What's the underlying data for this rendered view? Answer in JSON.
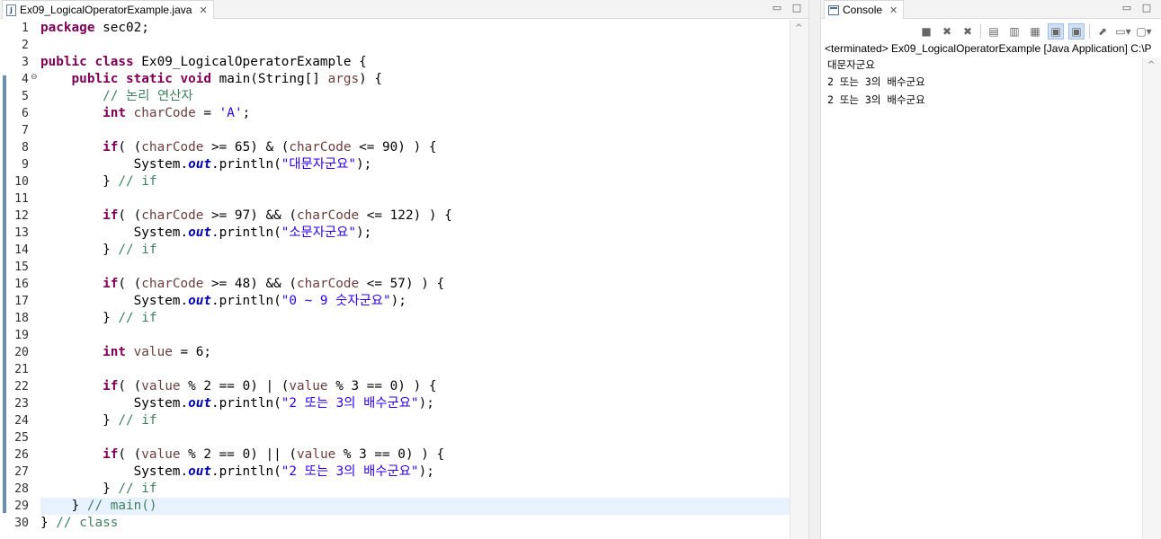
{
  "editor": {
    "tab_label": "Ex09_LogicalOperatorExample.java",
    "tab_icon": "java-file-icon",
    "line_numbers": [
      "1",
      "2",
      "3",
      "4",
      "5",
      "6",
      "7",
      "8",
      "9",
      "10",
      "11",
      "12",
      "13",
      "14",
      "15",
      "16",
      "17",
      "18",
      "19",
      "20",
      "21",
      "22",
      "23",
      "24",
      "25",
      "26",
      "27",
      "28",
      "29",
      "30"
    ],
    "current_line": 29,
    "lines": [
      [
        {
          "t": "package",
          "c": "kw"
        },
        {
          "t": " sec02;"
        }
      ],
      [],
      [
        {
          "t": "public",
          "c": "kw"
        },
        {
          "t": " "
        },
        {
          "t": "class",
          "c": "kw"
        },
        {
          "t": " Ex09_LogicalOperatorExample {"
        }
      ],
      [
        {
          "t": "    "
        },
        {
          "t": "public",
          "c": "kw"
        },
        {
          "t": " "
        },
        {
          "t": "static",
          "c": "kw"
        },
        {
          "t": " "
        },
        {
          "t": "void",
          "c": "kw"
        },
        {
          "t": " main(String[] "
        },
        {
          "t": "args",
          "c": "var"
        },
        {
          "t": ") {"
        }
      ],
      [
        {
          "t": "        "
        },
        {
          "t": "// 논리 연산자",
          "c": "cmt"
        }
      ],
      [
        {
          "t": "        "
        },
        {
          "t": "int",
          "c": "kw"
        },
        {
          "t": " "
        },
        {
          "t": "charCode",
          "c": "var"
        },
        {
          "t": " = "
        },
        {
          "t": "'A'",
          "c": "str"
        },
        {
          "t": ";"
        }
      ],
      [],
      [
        {
          "t": "        "
        },
        {
          "t": "if",
          "c": "kw"
        },
        {
          "t": "( ("
        },
        {
          "t": "charCode",
          "c": "var"
        },
        {
          "t": " >= 65) & ("
        },
        {
          "t": "charCode",
          "c": "var"
        },
        {
          "t": " <= 90) ) {"
        }
      ],
      [
        {
          "t": "            System."
        },
        {
          "t": "out",
          "c": "fld"
        },
        {
          "t": ".println("
        },
        {
          "t": "\"대문자군요\"",
          "c": "str"
        },
        {
          "t": ");"
        }
      ],
      [
        {
          "t": "        } "
        },
        {
          "t": "// if",
          "c": "cmt"
        }
      ],
      [],
      [
        {
          "t": "        "
        },
        {
          "t": "if",
          "c": "kw"
        },
        {
          "t": "( ("
        },
        {
          "t": "charCode",
          "c": "var"
        },
        {
          "t": " >= 97) && ("
        },
        {
          "t": "charCode",
          "c": "var"
        },
        {
          "t": " <= 122) ) {"
        }
      ],
      [
        {
          "t": "            System."
        },
        {
          "t": "out",
          "c": "fld"
        },
        {
          "t": ".println("
        },
        {
          "t": "\"소문자군요\"",
          "c": "str"
        },
        {
          "t": ");"
        }
      ],
      [
        {
          "t": "        } "
        },
        {
          "t": "// if",
          "c": "cmt"
        }
      ],
      [],
      [
        {
          "t": "        "
        },
        {
          "t": "if",
          "c": "kw"
        },
        {
          "t": "( ("
        },
        {
          "t": "charCode",
          "c": "var"
        },
        {
          "t": " >= 48) && ("
        },
        {
          "t": "charCode",
          "c": "var"
        },
        {
          "t": " <= 57) ) {"
        }
      ],
      [
        {
          "t": "            System."
        },
        {
          "t": "out",
          "c": "fld"
        },
        {
          "t": ".println("
        },
        {
          "t": "\"0 ~ 9 숫자군요\"",
          "c": "str"
        },
        {
          "t": ");"
        }
      ],
      [
        {
          "t": "        } "
        },
        {
          "t": "// if",
          "c": "cmt"
        }
      ],
      [],
      [
        {
          "t": "        "
        },
        {
          "t": "int",
          "c": "kw"
        },
        {
          "t": " "
        },
        {
          "t": "value",
          "c": "var"
        },
        {
          "t": " = 6;"
        }
      ],
      [],
      [
        {
          "t": "        "
        },
        {
          "t": "if",
          "c": "kw"
        },
        {
          "t": "( ("
        },
        {
          "t": "value",
          "c": "var"
        },
        {
          "t": " % 2 == 0) | ("
        },
        {
          "t": "value",
          "c": "var"
        },
        {
          "t": " % 3 == 0) ) {"
        }
      ],
      [
        {
          "t": "            System."
        },
        {
          "t": "out",
          "c": "fld"
        },
        {
          "t": ".println("
        },
        {
          "t": "\"2 또는 3의 배수군요\"",
          "c": "str"
        },
        {
          "t": ");"
        }
      ],
      [
        {
          "t": "        } "
        },
        {
          "t": "// if",
          "c": "cmt"
        }
      ],
      [],
      [
        {
          "t": "        "
        },
        {
          "t": "if",
          "c": "kw"
        },
        {
          "t": "( ("
        },
        {
          "t": "value",
          "c": "var"
        },
        {
          "t": " % 2 == 0) || ("
        },
        {
          "t": "value",
          "c": "var"
        },
        {
          "t": " % 3 == 0) ) {"
        }
      ],
      [
        {
          "t": "            System."
        },
        {
          "t": "out",
          "c": "fld"
        },
        {
          "t": ".println("
        },
        {
          "t": "\"2 또는 3의 배수군요\"",
          "c": "str"
        },
        {
          "t": ");"
        }
      ],
      [
        {
          "t": "        } "
        },
        {
          "t": "// if",
          "c": "cmt"
        }
      ],
      [
        {
          "t": "    } "
        },
        {
          "t": "// main()",
          "c": "cmt"
        }
      ],
      [
        {
          "t": "} "
        },
        {
          "t": "// class",
          "c": "cmt"
        }
      ]
    ],
    "colors": {
      "keyword": "#7f0055",
      "comment": "#3f7f5f",
      "string": "#2a00ff",
      "field": "#0000c0",
      "variable": "#6a3e3e",
      "current_line": "#e8f2fe",
      "ruler": "#6a8fb0"
    }
  },
  "console": {
    "tab_label": "Console",
    "tab_icon": "console-icon",
    "toolbar_icons": [
      "terminate-icon",
      "remove-launch-icon",
      "remove-all-terminated-icon",
      "clear-console-icon",
      "scroll-lock-icon",
      "word-wrap-icon",
      "show-on-stdout-icon",
      "show-on-stderr-icon",
      "pin-console-icon",
      "display-console-icon",
      "open-console-icon"
    ],
    "status": "<terminated> Ex09_LogicalOperatorExample [Java Application] C:\\P",
    "output": [
      "대문자군요",
      "2 또는 3의 배수군요",
      "2 또는 3의 배수군요"
    ]
  }
}
